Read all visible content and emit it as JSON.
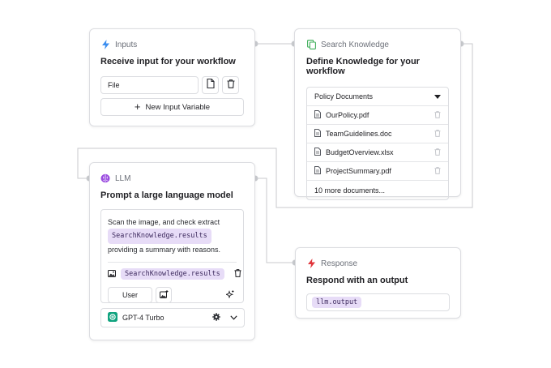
{
  "colors": {
    "wire": "#c8cace",
    "lightning_blue": "#3b8ef0",
    "knowledge_green": "#3fae5a",
    "llm_purple": "#9b4de0",
    "response_red": "#e0353b",
    "pill_bg": "#e7dcf7"
  },
  "inputs_node": {
    "icon": "lightning-icon",
    "label": "Inputs",
    "title": "Receive input for your workflow",
    "field_value": "File",
    "new_variable_label": "New Input Variable"
  },
  "knowledge_node": {
    "icon": "copy-stack-icon",
    "label": "Search Knowledge",
    "title": "Define Knowledge for your workflow",
    "dropdown_value": "Policy Documents",
    "documents": [
      {
        "name": "OurPolicy.pdf"
      },
      {
        "name": "TeamGuidelines.doc"
      },
      {
        "name": "BudgetOverview.xlsx"
      },
      {
        "name": "ProjectSummary.pdf"
      }
    ],
    "more_label": "10 more documents..."
  },
  "llm_node": {
    "icon": "brain-icon",
    "label": "LLM",
    "title": "Prompt a large language model",
    "prompt_before": "Scan the image, and check extract",
    "prompt_variable": "SearchKnowledge.results",
    "prompt_after": "providing a summary with reasons.",
    "image_variable": "SearchKnowledge.results",
    "role_label": "User",
    "model_label": "GPT-4 Turbo"
  },
  "response_node": {
    "icon": "lightning-icon",
    "label": "Response",
    "title": "Respond with an output",
    "output_variable": "llm.output"
  }
}
